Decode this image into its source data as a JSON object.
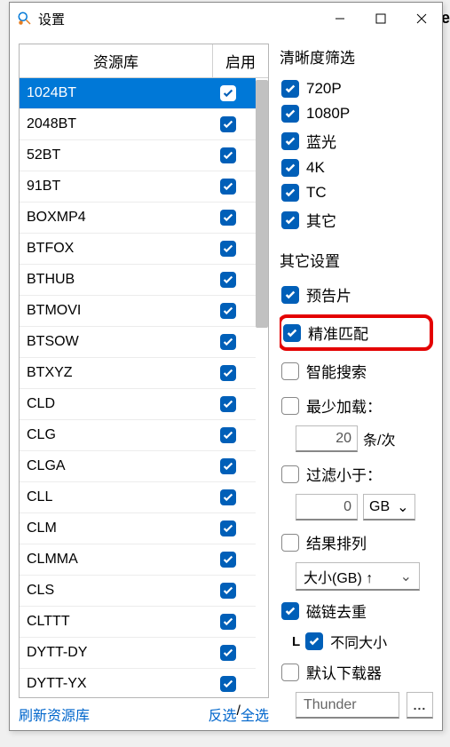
{
  "window": {
    "title": "设置",
    "minimize": "–",
    "maximize": "□",
    "close": "✕"
  },
  "table": {
    "col_name": "资源库",
    "col_enable": "启用",
    "rows": [
      {
        "name": "1024BT",
        "enabled": true,
        "selected": true
      },
      {
        "name": "2048BT",
        "enabled": true
      },
      {
        "name": "52BT",
        "enabled": true
      },
      {
        "name": "91BT",
        "enabled": true
      },
      {
        "name": "BOXMP4",
        "enabled": true
      },
      {
        "name": "BTFOX",
        "enabled": true
      },
      {
        "name": "BTHUB",
        "enabled": true
      },
      {
        "name": "BTMOVI",
        "enabled": true
      },
      {
        "name": "BTSOW",
        "enabled": true
      },
      {
        "name": "BTXYZ",
        "enabled": true
      },
      {
        "name": "CLD",
        "enabled": true
      },
      {
        "name": "CLG",
        "enabled": true
      },
      {
        "name": "CLGA",
        "enabled": true
      },
      {
        "name": "CLL",
        "enabled": true
      },
      {
        "name": "CLM",
        "enabled": true
      },
      {
        "name": "CLMMA",
        "enabled": true
      },
      {
        "name": "CLS",
        "enabled": true
      },
      {
        "name": "CLTTT",
        "enabled": true
      },
      {
        "name": "DYTT-DY",
        "enabled": true
      },
      {
        "name": "DYTT-YX",
        "enabled": true
      }
    ],
    "footer": {
      "refresh": "刷新资源库",
      "invert": "反选",
      "sep": " / ",
      "all": "全选"
    }
  },
  "filter": {
    "title": "清晰度筛选",
    "opts": [
      {
        "label": "720P",
        "on": true
      },
      {
        "label": "1080P",
        "on": true
      },
      {
        "label": "蓝光",
        "on": true
      },
      {
        "label": "4K",
        "on": true
      },
      {
        "label": "TC",
        "on": true
      },
      {
        "label": "其它",
        "on": true
      }
    ]
  },
  "other": {
    "title": "其它设置",
    "trailer": {
      "label": "预告片",
      "on": true
    },
    "exact": {
      "label": "精准匹配",
      "on": true
    },
    "smart": {
      "label": "智能搜索",
      "on": false
    },
    "min_load": {
      "label": "最少加载：",
      "on": false,
      "value": "20",
      "suffix": "条/次"
    },
    "filter_lt": {
      "label": "过滤小于：",
      "on": false,
      "value": "0",
      "unit": "GB"
    },
    "sort": {
      "label": "结果排列",
      "on": false,
      "value": "大小(GB) ↑"
    },
    "dedupe": {
      "label": "磁链去重",
      "on": true
    },
    "dedupe_size": {
      "label": "不同大小",
      "on": true
    },
    "default_dl": {
      "label": "默认下载器",
      "on": false,
      "value": "Thunder",
      "browse": "..."
    }
  }
}
